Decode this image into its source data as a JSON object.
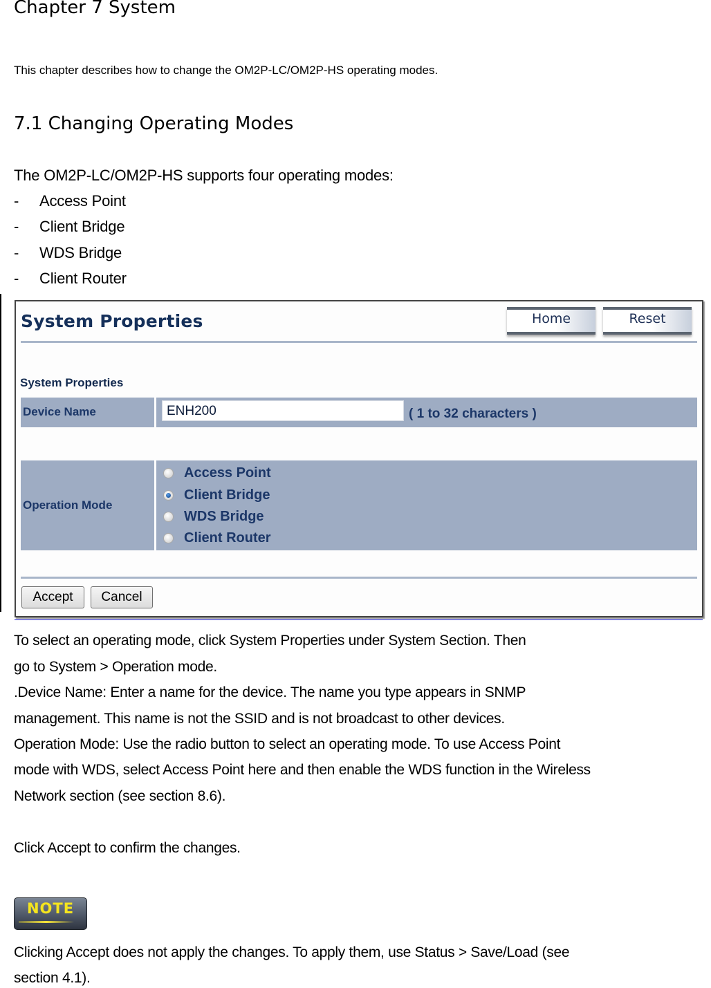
{
  "doc": {
    "chapter_title": "Chapter  7 System",
    "intro": "This chapter describes how to change the OM2P-LC/OM2P-HS operating modes.",
    "section_title": "7.1 Changing  Operating  Modes",
    "supports_line": "The OM2P-LC/OM2P-HS supports four operating modes:",
    "bullet_marker": "-",
    "modes": [
      "Access Point",
      "Client Bridge",
      "WDS Bridge",
      "Client Router"
    ]
  },
  "screenshot": {
    "title": "System Properties",
    "header_buttons": {
      "home": "Home",
      "reset": "Reset"
    },
    "section_label": "System Properties",
    "device_name_label": "Device Name",
    "device_name_value": "ENH200",
    "device_name_hint": "( 1 to 32 characters )",
    "operation_mode_label": "Operation Mode",
    "operation_modes": [
      {
        "label": "Access Point",
        "checked": false
      },
      {
        "label": "Client Bridge",
        "checked": true
      },
      {
        "label": "WDS Bridge",
        "checked": false
      },
      {
        "label": "Client Router",
        "checked": false
      }
    ],
    "selected_mode": "Client Bridge",
    "accept_label": "Accept",
    "cancel_label": "Cancel",
    "colors": {
      "title": "#15305a",
      "cell_bg": "#9eacc3",
      "label_text": "#1c3768"
    }
  },
  "body": {
    "lines": [
      "To select an operating mode, click System  Properties under System  Section.  Then",
      "go to System  > Operation  mode.",
      ".Device  Name:  Enter a name for the device. The name you type appears in SNMP",
      "management. This name is not the SSID and is not broadcast to other devices.",
      "Operation  Mode:  Use the radio button to select an operating mode. To use Access Point",
      "mode with WDS, select Access  Point  here and then enable the WDS function in the Wireless",
      "Network section (see section 8.6)."
    ],
    "confirm_line": "Click Accept  to confirm the changes.",
    "note_badge": "NOTE",
    "note_lines": [
      "Clicking Accept  does not apply the changes. To apply them, use Status  > Save/Load  (see",
      "section 4.1)."
    ]
  }
}
